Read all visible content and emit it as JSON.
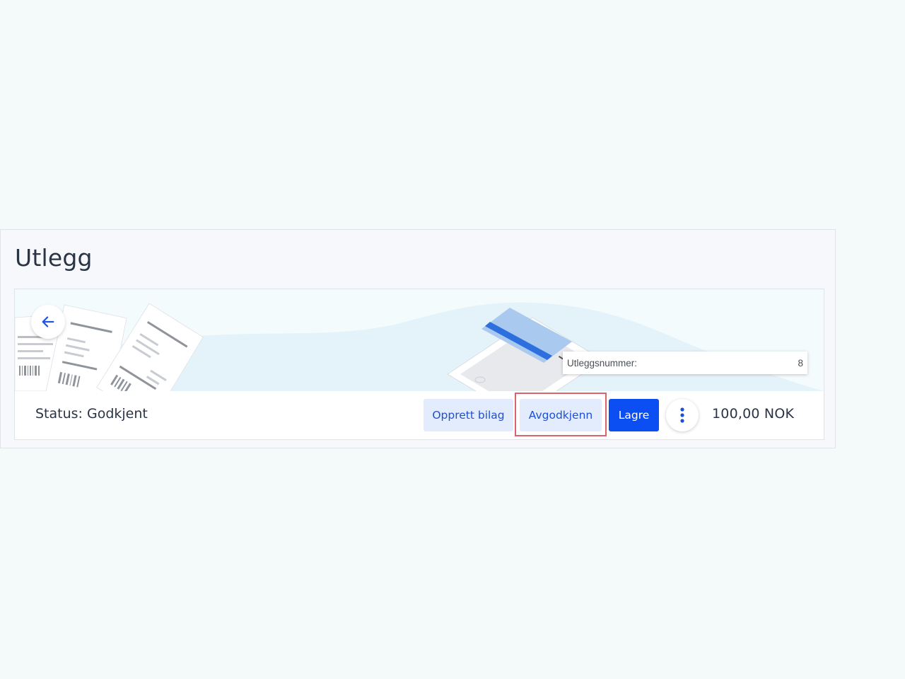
{
  "page": {
    "title": "Utlegg"
  },
  "header": {
    "back_icon": "arrow-left-icon",
    "number_label": "Utleggsnummer:",
    "number_value": "8"
  },
  "footer": {
    "status": "Status: Godkjent",
    "buttons": {
      "create_voucher": "Opprett bilag",
      "unapprove": "Avgodkjenn",
      "save": "Lagre"
    },
    "more_icon": "more-vertical-icon",
    "amount": "100,00 NOK"
  },
  "colors": {
    "accent": "#0b4ff2",
    "secondary_button_bg": "#e3ecfd",
    "highlight": "#d9646b",
    "text": "#2b3445"
  }
}
